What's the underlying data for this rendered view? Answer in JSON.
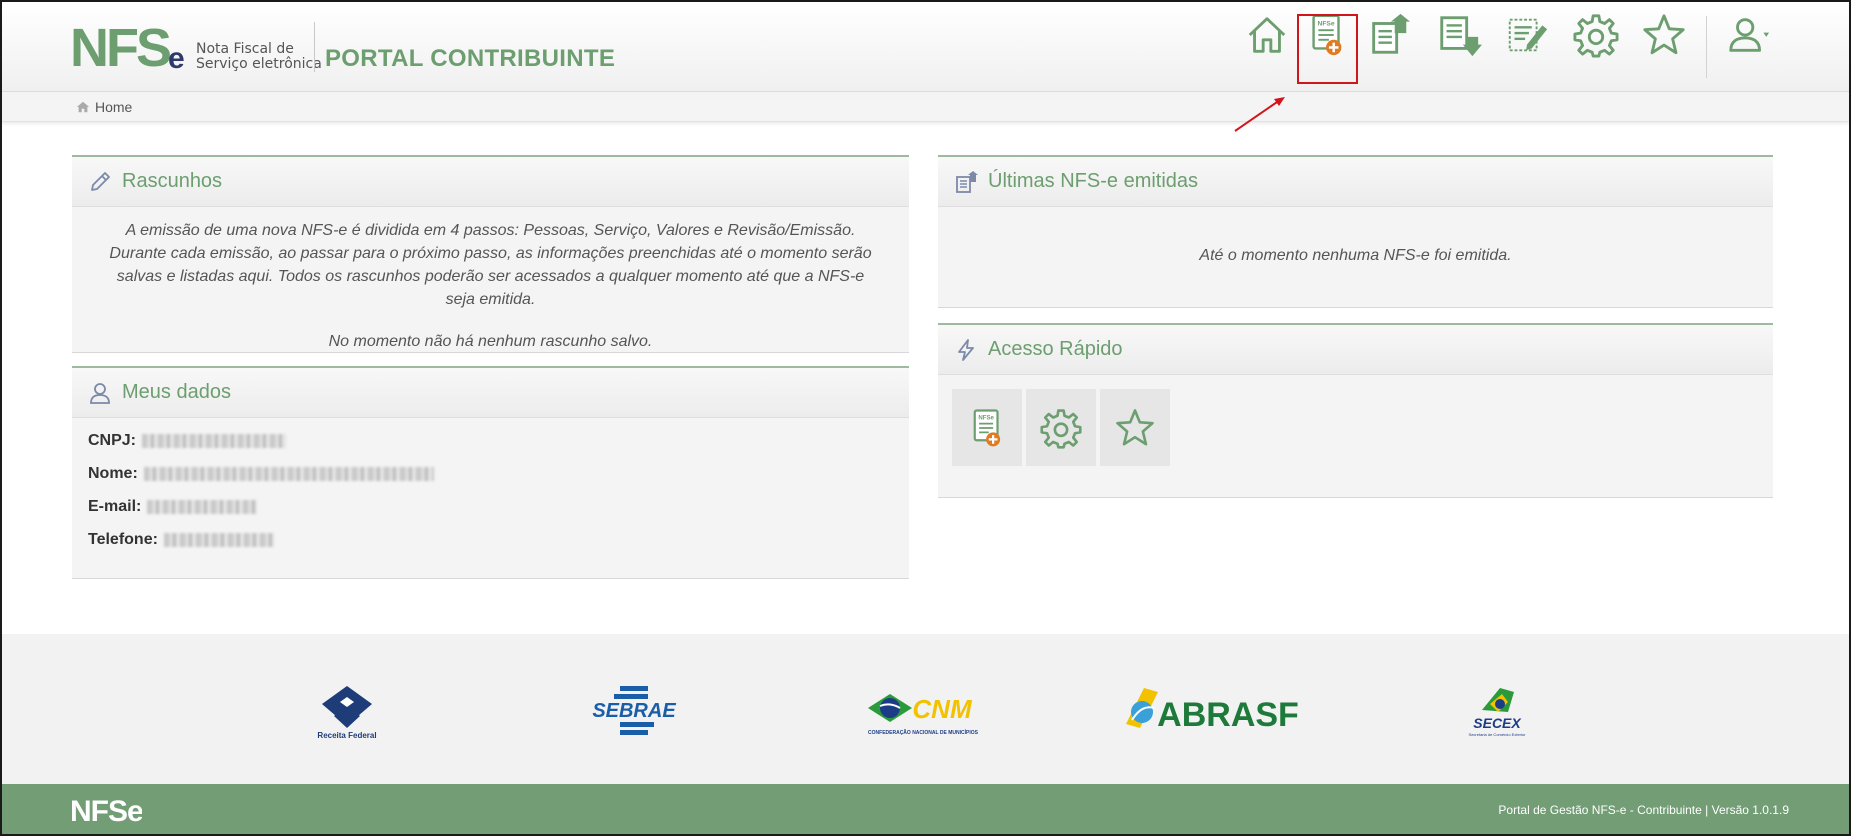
{
  "header": {
    "logo_text": "NFSe",
    "logo_sub_line1": "Nota Fiscal de",
    "logo_sub_line2": "Serviço eletrônica",
    "portal_title": "PORTAL CONTRIBUINTE",
    "nav": [
      {
        "name": "home-icon",
        "label": ""
      },
      {
        "name": "nfse-new-icon",
        "label": "NFSe"
      },
      {
        "name": "document-upload-icon",
        "label": ""
      },
      {
        "name": "document-download-icon",
        "label": ""
      },
      {
        "name": "document-edit-icon",
        "label": ""
      },
      {
        "name": "gear-icon",
        "label": ""
      },
      {
        "name": "star-icon",
        "label": ""
      },
      {
        "name": "user-icon",
        "label": ""
      }
    ]
  },
  "breadcrumb": {
    "home": "Home"
  },
  "rascunhos": {
    "title": "Rascunhos",
    "description": "A emissão de uma nova NFS-e é dividida em 4 passos: Pessoas, Serviço, Valores e Revisão/Emissão. Durante cada emissão, ao passar para o próximo passo, as informações preenchidas até o momento serão salvas e listadas aqui. Todos os rascunhos poderão ser acessados a qualquer momento até que a NFS-e seja emitida.",
    "empty": "No momento não há nenhum rascunho salvo."
  },
  "meus_dados": {
    "title": "Meus dados",
    "cnpj_label": "CNPJ:",
    "nome_label": "Nome:",
    "email_label": "E-mail:",
    "telefone_label": "Telefone:"
  },
  "ultimas": {
    "title": "Últimas NFS-e emitidas",
    "empty": "Até o momento nenhuma NFS-e foi emitida."
  },
  "acesso": {
    "title": "Acesso Rápido",
    "nfse_label": "NFSe"
  },
  "sponsors": {
    "receita": "Receita Federal",
    "sebrae": "SEBRAE",
    "cnm": "CNM",
    "cnm_sub": "CONFEDERAÇÃO NACIONAL DE MUNICÍPIOS",
    "abrasf": "ABRASF",
    "secex": "SECEX",
    "secex_sub": "Secretaria de Comércio Exterior"
  },
  "footer": {
    "logo_text": "NFSe",
    "version_text": "Portal de Gestão NFS-e - Contribuinte | Versão 1.0.1.9"
  },
  "colors": {
    "brand_green": "#6c9e6f",
    "footer_green": "#729d75",
    "navy": "#2e3a6b",
    "highlight_red": "#d0161c",
    "orange": "#e07b22"
  }
}
